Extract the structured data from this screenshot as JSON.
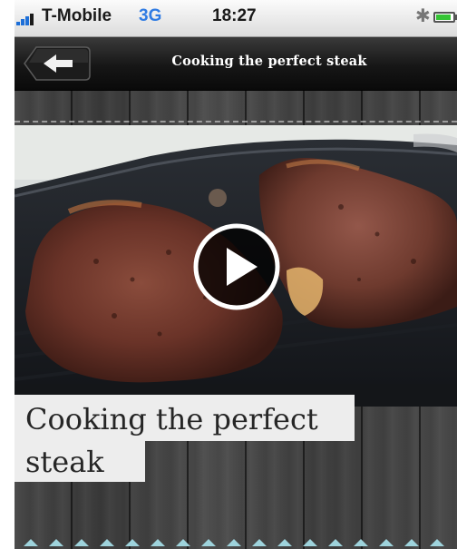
{
  "status_bar": {
    "carrier": "T-Mobile",
    "network": "3G",
    "time": "18:27",
    "bluetooth_icon": "bluetooth-icon",
    "battery_level": 0.9
  },
  "nav_bar": {
    "back_icon": "back-arrow-icon",
    "title": "Cooking the perfect steak"
  },
  "video": {
    "play_icon": "play-icon"
  },
  "caption": {
    "line1": "Cooking the perfect",
    "line2": "steak"
  },
  "colors": {
    "nav_bar": "#161616",
    "wood": "#444444",
    "caption_bg": "#ededed",
    "caption_text": "#262626",
    "stitch": "#9ed3dc"
  }
}
